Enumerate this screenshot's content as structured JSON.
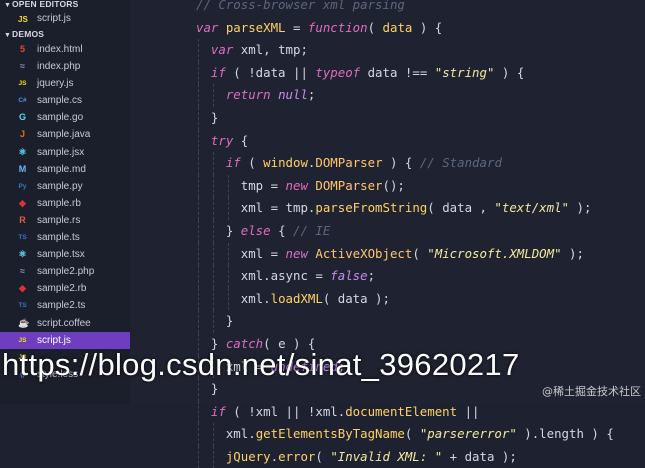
{
  "sidebar": {
    "open_editors_label": "OPEN EDITORS",
    "open_editor_file": "script.js",
    "demos_label": "DEMOS",
    "files": [
      {
        "name": "index.html",
        "icon": "html5-icon",
        "color": "#e44d26",
        "glyph": "5"
      },
      {
        "name": "index.php",
        "icon": "php-icon",
        "color": "#8892bf",
        "glyph": "≈"
      },
      {
        "name": "jquery.js",
        "icon": "js-icon",
        "color": "#f7df1e",
        "glyph": "JS"
      },
      {
        "name": "sample.cs",
        "icon": "csharp-icon",
        "color": "#5b8ee6",
        "glyph": "C#"
      },
      {
        "name": "sample.go",
        "icon": "go-icon",
        "color": "#5ed3f3",
        "glyph": "G"
      },
      {
        "name": "sample.java",
        "icon": "java-icon",
        "color": "#e76f00",
        "glyph": "J"
      },
      {
        "name": "sample.jsx",
        "icon": "react-icon",
        "color": "#61dafb",
        "glyph": "⚛"
      },
      {
        "name": "sample.md",
        "icon": "markdown-icon",
        "color": "#6fb3ff",
        "glyph": "M"
      },
      {
        "name": "sample.py",
        "icon": "python-icon",
        "color": "#3c78aa",
        "glyph": "Py"
      },
      {
        "name": "sample.rb",
        "icon": "ruby-icon",
        "color": "#e0313b",
        "glyph": "◆"
      },
      {
        "name": "sample.rs",
        "icon": "rust-icon",
        "color": "#e05d44",
        "glyph": "R"
      },
      {
        "name": "sample.ts",
        "icon": "typescript-icon",
        "color": "#3178c6",
        "glyph": "TS"
      },
      {
        "name": "sample.tsx",
        "icon": "react-icon",
        "color": "#61dafb",
        "glyph": "⚛"
      },
      {
        "name": "sample2.php",
        "icon": "php-icon",
        "color": "#8892bf",
        "glyph": "≈"
      },
      {
        "name": "sample2.rb",
        "icon": "ruby-icon",
        "color": "#e0313b",
        "glyph": "◆"
      },
      {
        "name": "sample2.ts",
        "icon": "typescript-icon",
        "color": "#3178c6",
        "glyph": "TS"
      },
      {
        "name": "script.coffee",
        "icon": "coffee-icon",
        "color": "#c9a37a",
        "glyph": "☕"
      },
      {
        "name": "script.js",
        "icon": "js-icon",
        "color": "#f7df1e",
        "glyph": "JS",
        "active": true
      },
      {
        "name": "",
        "icon": "js-icon",
        "color": "#f7df1e",
        "glyph": "JS"
      },
      {
        "name": "style.less",
        "icon": "less-icon",
        "color": "#5b8ee6",
        "glyph": "{}"
      }
    ]
  },
  "editor": {
    "accent": "#6d3fc0",
    "lines": [
      {
        "indent": 0,
        "tokens": [
          [
            "cm",
            "// Cross-browser xml parsing"
          ]
        ]
      },
      {
        "indent": 0,
        "tokens": [
          [
            "kw",
            "var "
          ],
          [
            "fn",
            "parseXML"
          ],
          [
            "pn",
            " = "
          ],
          [
            "kw",
            "function"
          ],
          [
            "pn",
            "( "
          ],
          [
            "fn",
            "data"
          ],
          [
            "pn",
            " ) {"
          ]
        ]
      },
      {
        "indent": 1,
        "tokens": [
          [
            "kw",
            "var "
          ],
          [
            "pn",
            "xml, tmp;"
          ]
        ]
      },
      {
        "indent": 1,
        "tokens": [
          [
            "kw",
            "if"
          ],
          [
            "pn",
            " ( !data || "
          ],
          [
            "kw",
            "typeof"
          ],
          [
            "pn",
            " data !== "
          ],
          [
            "str",
            "\"string\""
          ],
          [
            "pn",
            " ) {"
          ]
        ]
      },
      {
        "indent": 2,
        "tokens": [
          [
            "kw",
            "return "
          ],
          [
            "kw2",
            "null"
          ],
          [
            "pn",
            ";"
          ]
        ]
      },
      {
        "indent": 1,
        "tokens": [
          [
            "pn",
            "}"
          ]
        ]
      },
      {
        "indent": 1,
        "tokens": [
          [
            "kw",
            "try"
          ],
          [
            "pn",
            " {"
          ]
        ]
      },
      {
        "indent": 2,
        "tokens": [
          [
            "kw",
            "if"
          ],
          [
            "pn",
            " ( "
          ],
          [
            "fn",
            "window"
          ],
          [
            "pn",
            "."
          ],
          [
            "cls",
            "DOMParser"
          ],
          [
            "pn",
            " ) { "
          ],
          [
            "cm",
            "// Standard"
          ]
        ]
      },
      {
        "indent": 3,
        "tokens": [
          [
            "pn",
            "tmp = "
          ],
          [
            "kw",
            "new "
          ],
          [
            "cls",
            "DOMParser"
          ],
          [
            "pn",
            "();"
          ]
        ]
      },
      {
        "indent": 3,
        "tokens": [
          [
            "pn",
            "xml = tmp."
          ],
          [
            "fn",
            "parseFromString"
          ],
          [
            "pn",
            "( data , "
          ],
          [
            "str",
            "\"text/xml\""
          ],
          [
            "pn",
            " );"
          ]
        ]
      },
      {
        "indent": 2,
        "tokens": [
          [
            "pn",
            "} "
          ],
          [
            "kw",
            "else"
          ],
          [
            "pn",
            " { "
          ],
          [
            "cm",
            "// IE"
          ]
        ]
      },
      {
        "indent": 3,
        "tokens": [
          [
            "pn",
            "xml = "
          ],
          [
            "kw",
            "new "
          ],
          [
            "cls",
            "ActiveXObject"
          ],
          [
            "pn",
            "( "
          ],
          [
            "str",
            "\"Microsoft.XMLDOM\""
          ],
          [
            "pn",
            " );"
          ]
        ]
      },
      {
        "indent": 3,
        "tokens": [
          [
            "pn",
            "xml.async = "
          ],
          [
            "kw2",
            "false"
          ],
          [
            "pn",
            ";"
          ]
        ]
      },
      {
        "indent": 3,
        "tokens": [
          [
            "pn",
            "xml."
          ],
          [
            "fn",
            "loadXML"
          ],
          [
            "pn",
            "( data );"
          ]
        ]
      },
      {
        "indent": 2,
        "tokens": [
          [
            "pn",
            "}"
          ]
        ]
      },
      {
        "indent": 1,
        "tokens": [
          [
            "pn",
            "} "
          ],
          [
            "kw",
            "catch"
          ],
          [
            "pn",
            "( e ) {"
          ]
        ]
      },
      {
        "indent": 2,
        "tokens": [
          [
            "pn",
            "xml = "
          ],
          [
            "kw2",
            "undefined"
          ],
          [
            "pn",
            ";"
          ]
        ]
      },
      {
        "indent": 1,
        "tokens": [
          [
            "pn",
            "}"
          ]
        ]
      },
      {
        "indent": 1,
        "tokens": [
          [
            "kw",
            "if"
          ],
          [
            "pn",
            " ( !xml || !xml."
          ],
          [
            "fn",
            "documentElement"
          ],
          [
            "pn",
            " ||"
          ]
        ]
      },
      {
        "indent": 2,
        "tokens": [
          [
            "pn",
            "xml."
          ],
          [
            "fn",
            "getElementsByTagName"
          ],
          [
            "pn",
            "( "
          ],
          [
            "str",
            "\"parsererror\""
          ],
          [
            "pn",
            " ).length ) {"
          ]
        ]
      },
      {
        "indent": 2,
        "tokens": [
          [
            "fn",
            "jQuery"
          ],
          [
            "pn",
            "."
          ],
          [
            "fn",
            "error"
          ],
          [
            "pn",
            "( "
          ],
          [
            "str",
            "\"Invalid XML: \""
          ],
          [
            "pn",
            " + data );"
          ]
        ]
      }
    ]
  },
  "watermark": {
    "text": "https://blog.csdn.net/sinat_39620217",
    "secondary": "@稀土掘金技术社区"
  }
}
